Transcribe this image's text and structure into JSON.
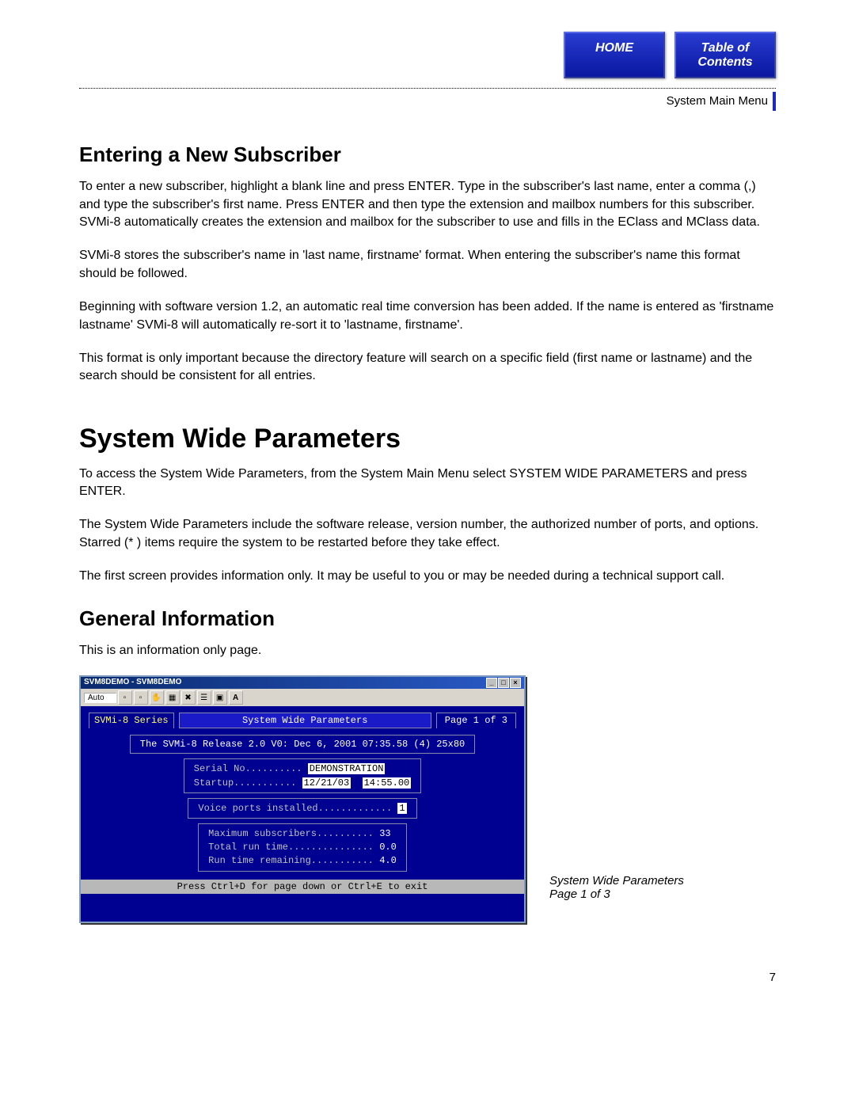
{
  "nav": {
    "home": "HOME",
    "toc": "Table of\nContents"
  },
  "breadcrumb": "System Main Menu",
  "sections": {
    "sub_title": "Entering a New Subscriber",
    "sub_p1": "To enter a new subscriber, highlight a blank line and press ENTER. Type in the subscriber's last name, enter a comma (,) and type the subscriber's first name. Press ENTER and then type the extension and mailbox numbers for this subscriber. SVMi-8 automatically creates the extension and mailbox for the subscriber to use and fills in the EClass and MClass data.",
    "sub_p2": "SVMi-8 stores the subscriber's name in 'last name, firstname' format. When entering the subscriber's name this format should be followed.",
    "sub_p3": "Beginning with software version 1.2, an automatic real time conversion has been added. If the name is entered as 'firstname lastname' SVMi-8 will automatically re-sort it to 'lastname, firstname'.",
    "sub_p4": "This format is only important because the directory feature will search on a specific field (first name or lastname) and the search should be consistent for all entries.",
    "swp_title": "System Wide Parameters",
    "swp_p1": "To access the System Wide Parameters, from the System Main Menu select SYSTEM WIDE PARAMETERS and press ENTER.",
    "swp_p2": "The System Wide Parameters include the software release, version number, the authorized number of ports, and options. Starred (* ) items require the system to be restarted before they take effect.",
    "swp_p3": "The first screen provides information only. It may be useful to you or may be needed during a technical support call.",
    "gi_title": "General Information",
    "gi_p1": "This is an information only page."
  },
  "terminal": {
    "win_title": "SVM8DEMO - SVM8DEMO",
    "dropdown": "Auto",
    "hdr_left": "SVMi-8 Series",
    "hdr_mid": "System Wide Parameters",
    "hdr_right": "Page 1 of 3",
    "release_line": "The SVMi-8 Release 2.0  V0: Dec 6, 2001 07:35.58 (4) 25x80",
    "serial_label": "Serial No..........",
    "serial_val": "DEMONSTRATION",
    "startup_label": "Startup...........",
    "startup_date": "12/21/03",
    "startup_time": "14:55.00",
    "voice_label": "Voice ports installed.............",
    "voice_val": "1",
    "maxsub_label": "Maximum subscribers..........",
    "maxsub_val": "33",
    "runtime_label": "Total run time...............",
    "runtime_val": "0.0",
    "remaining_label": "Run time remaining...........",
    "remaining_val": "4.0",
    "footer": "Press Ctrl+D for page down or Ctrl+E to exit"
  },
  "caption": {
    "title": "System Wide Parameters",
    "page": "Page 1 of 3"
  },
  "page_number": "7"
}
